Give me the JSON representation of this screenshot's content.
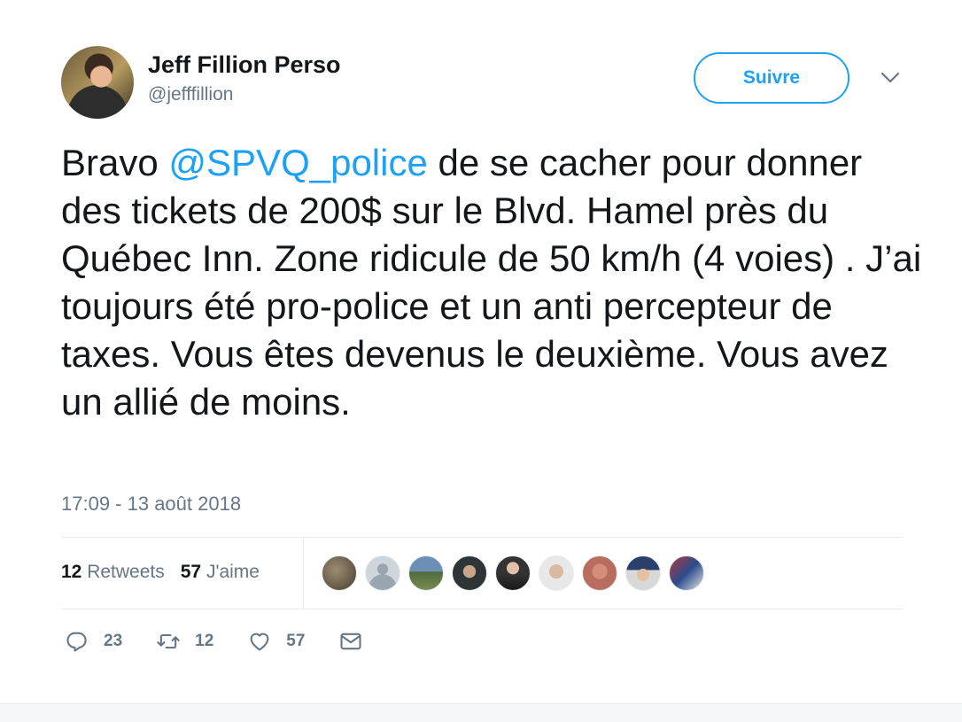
{
  "author": {
    "name": "Jeff Fillion Perso",
    "handle": "@jefffillion"
  },
  "follow_button": {
    "label": "Suivre"
  },
  "tweet": {
    "text_before": "Bravo ",
    "mention": "@SPVQ_police",
    "text_after": " de se cacher pour donner des tickets de 200$ sur le Blvd. Hamel près du Québec Inn. Zone ridicule de 50 km/h (4 voies) . J’ai toujours été pro-police et un anti percepteur de taxes. Vous êtes devenus le deuxième. Vous avez un allié de moins.",
    "timestamp": "17:09 - 13 août 2018"
  },
  "stats": {
    "retweets_count": "12",
    "retweets_label": "Retweets",
    "likes_count": "57",
    "likes_label": "J'aime"
  },
  "actions": {
    "reply_count": "23",
    "retweet_count": "12",
    "like_count": "57"
  },
  "colors": {
    "accent": "#1da1f2",
    "secondary_text": "#657786",
    "primary_text": "#14171a"
  },
  "icons": [
    "chevron-down-icon",
    "reply-icon",
    "retweet-icon",
    "heart-icon",
    "message-icon"
  ]
}
